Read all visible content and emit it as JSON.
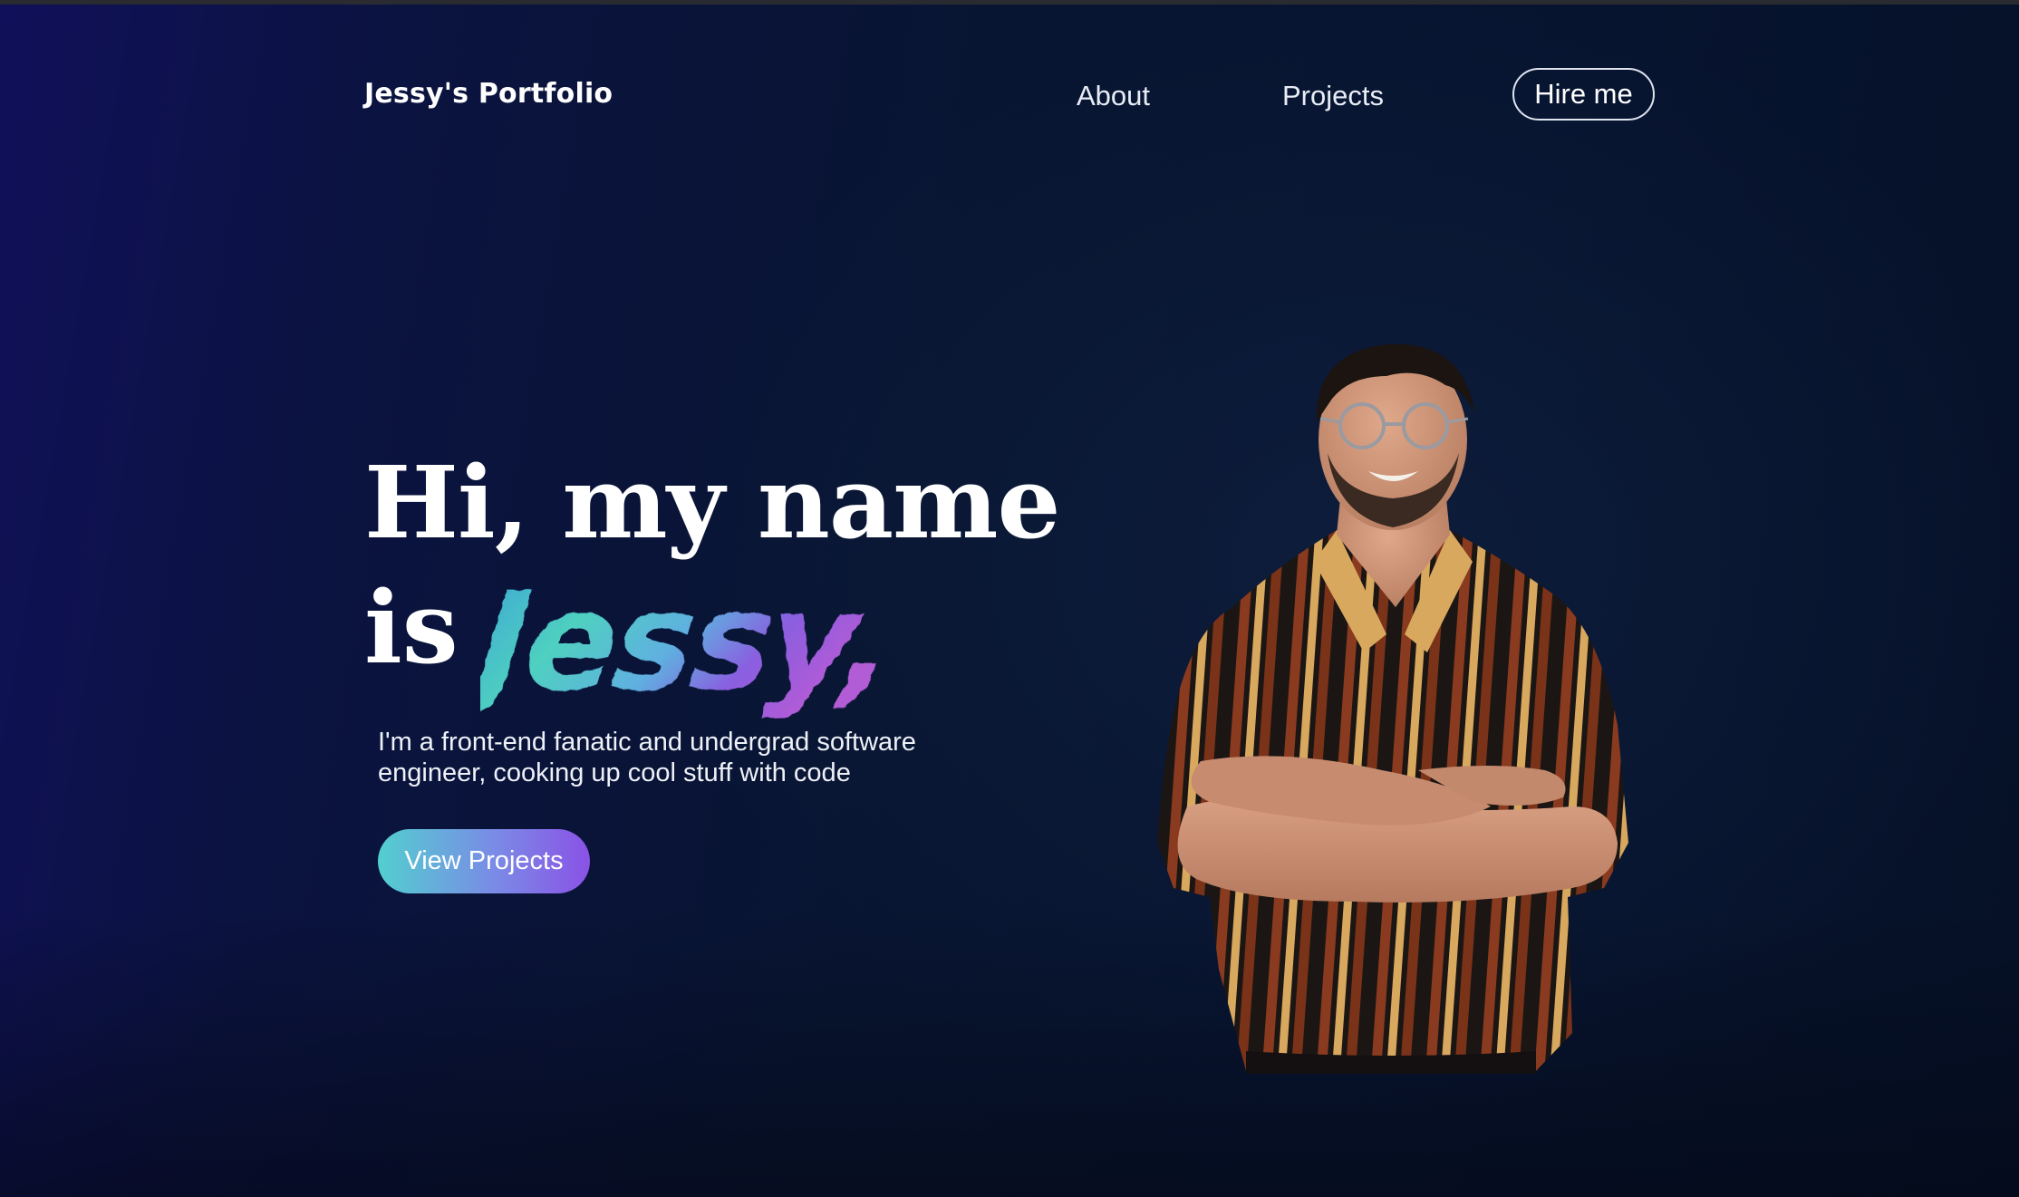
{
  "nav": {
    "logo": "Jessy's Portfolio",
    "links": [
      {
        "label": "About"
      },
      {
        "label": "Projects"
      }
    ],
    "cta_label": "Hire me"
  },
  "hero": {
    "headline_line1": "Hi, my name",
    "headline_line2_prefix": "is",
    "name_script": "Jessy,",
    "subtitle_line1": "I'm a front-end fanatic and undergrad software",
    "subtitle_line2": "engineer, cooking up cool stuff with code",
    "button_label": "View Projects"
  },
  "portrait": {
    "icon": "person-portrait-photo"
  },
  "colors": {
    "background_left": "#10105a",
    "background_right": "#071430",
    "gradient_teal": "#52cfcf",
    "gradient_purple": "#8a52e6",
    "text": "#ffffff"
  }
}
